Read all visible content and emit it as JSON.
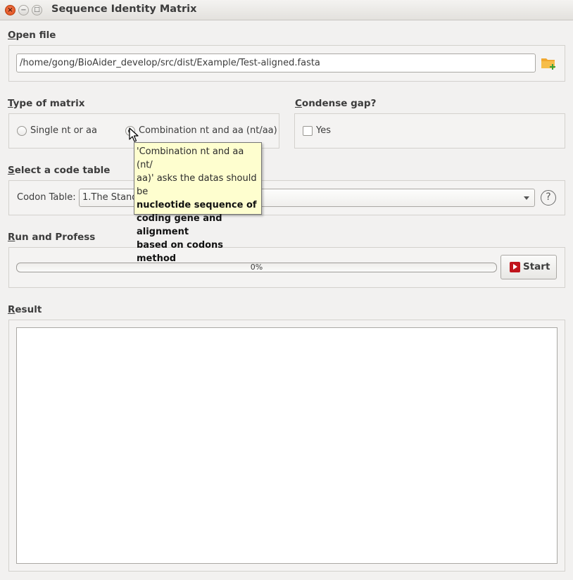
{
  "window": {
    "title": "Sequence Identity Matrix",
    "close_glyph": "×",
    "minimize_glyph": "−",
    "maximize_glyph": "□"
  },
  "open_file": {
    "label_accel": "O",
    "label_rest": "pen file",
    "path_value": "/home/gong/BioAider_develop/src/dist/Example/Test-aligned.fasta",
    "browse_icon": "folder-add-icon"
  },
  "matrix_type": {
    "label_accel": "T",
    "label_rest": "ype of matrix",
    "options": [
      {
        "label": "Single nt or aa",
        "checked": false
      },
      {
        "label": "Combination nt and aa (nt/aa)",
        "checked": true
      }
    ]
  },
  "condense_gap": {
    "label_accel": "C",
    "label_rest": "ondense gap?",
    "checkbox_label": "Yes",
    "checked": false
  },
  "code_table": {
    "label_accel": "S",
    "label_rest": "elect a code table",
    "field_label": "Codon Table:",
    "selected": "1.The Standard Code",
    "help_glyph": "?"
  },
  "run": {
    "label_accel": "R",
    "label_rest": "un and Profess",
    "progress_text": "0%",
    "progress_value": 0,
    "start_label": "Start"
  },
  "result": {
    "label_accel": "R",
    "label_rest": "esult"
  },
  "tooltip": {
    "line1": "'Combination nt and aa (nt/",
    "line2": "aa)' asks the datas should be",
    "line3": "nucleotide sequence of",
    "line4": "coding gene and alignment",
    "line5": "based on codons method"
  },
  "colors": {
    "background": "#f2f1f0",
    "close_button": "#df4b16",
    "start_icon": "#c0141b",
    "folder_icon": "#f0a830",
    "folder_plus": "#3aa13a",
    "tooltip_bg": "#fefecf"
  }
}
